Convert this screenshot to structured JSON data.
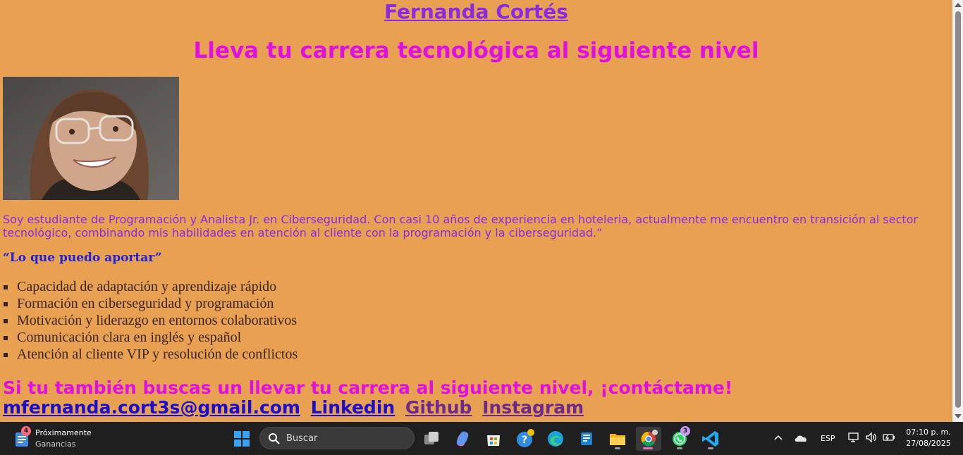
{
  "page": {
    "name": "Fernanda Cortés",
    "tagline": "Lleva tu carrera tecnológica al siguiente nivel",
    "bio": "Soy estudiante de Programación y Analista Jr. en Ciberseguridad. Con casi 10 años de experiencia en hoteleria, actualmente me encuentro en transición al sector tecnológico, combinando mis habilidades en atención al cliente con la programación y la ciberseguridad.”",
    "quote_title": "“Lo que puedo aportar”",
    "skills": [
      "Capacidad de adaptación y aprendizaje rápido",
      "Formación en ciberseguridad y programación",
      "Motivación y liderazgo en entornos colaborativos",
      "Comunicación clara en inglés y español",
      "Atención al cliente VIP y resolución de conflictos"
    ],
    "cta": "Si tu también buscas un llevar tu carrera al siguiente nivel, ¡contáctame!",
    "links": {
      "email": "mfernanda.cort3s@gmail.com",
      "linkedin": "Linkedin",
      "github": "Github",
      "instagram": "Instagram"
    }
  },
  "taskbar": {
    "widget": {
      "badge": "4",
      "line1": "Próximamente",
      "line2": "Ganancias"
    },
    "search_placeholder": "Buscar",
    "whatsapp_badge": "3",
    "language": "ESP",
    "time": "07:10 p. m.",
    "date": "27/08/2025",
    "icons": [
      "windows-start-icon",
      "task-view-icon",
      "copilot-icon",
      "microsoft-store-icon",
      "help-icon",
      "edge-icon",
      "app-icon",
      "file-explorer-icon",
      "chrome-icon",
      "whatsapp-icon",
      "vscode-icon"
    ]
  },
  "colors": {
    "background": "#e8a153",
    "name_link": "#8a2be2",
    "tagline": "#e010e0",
    "bio": "#8a2be2",
    "quote_title": "#2222d6",
    "link_unvisited": "#1a0dcc",
    "link_visited": "#6b2a8c"
  }
}
